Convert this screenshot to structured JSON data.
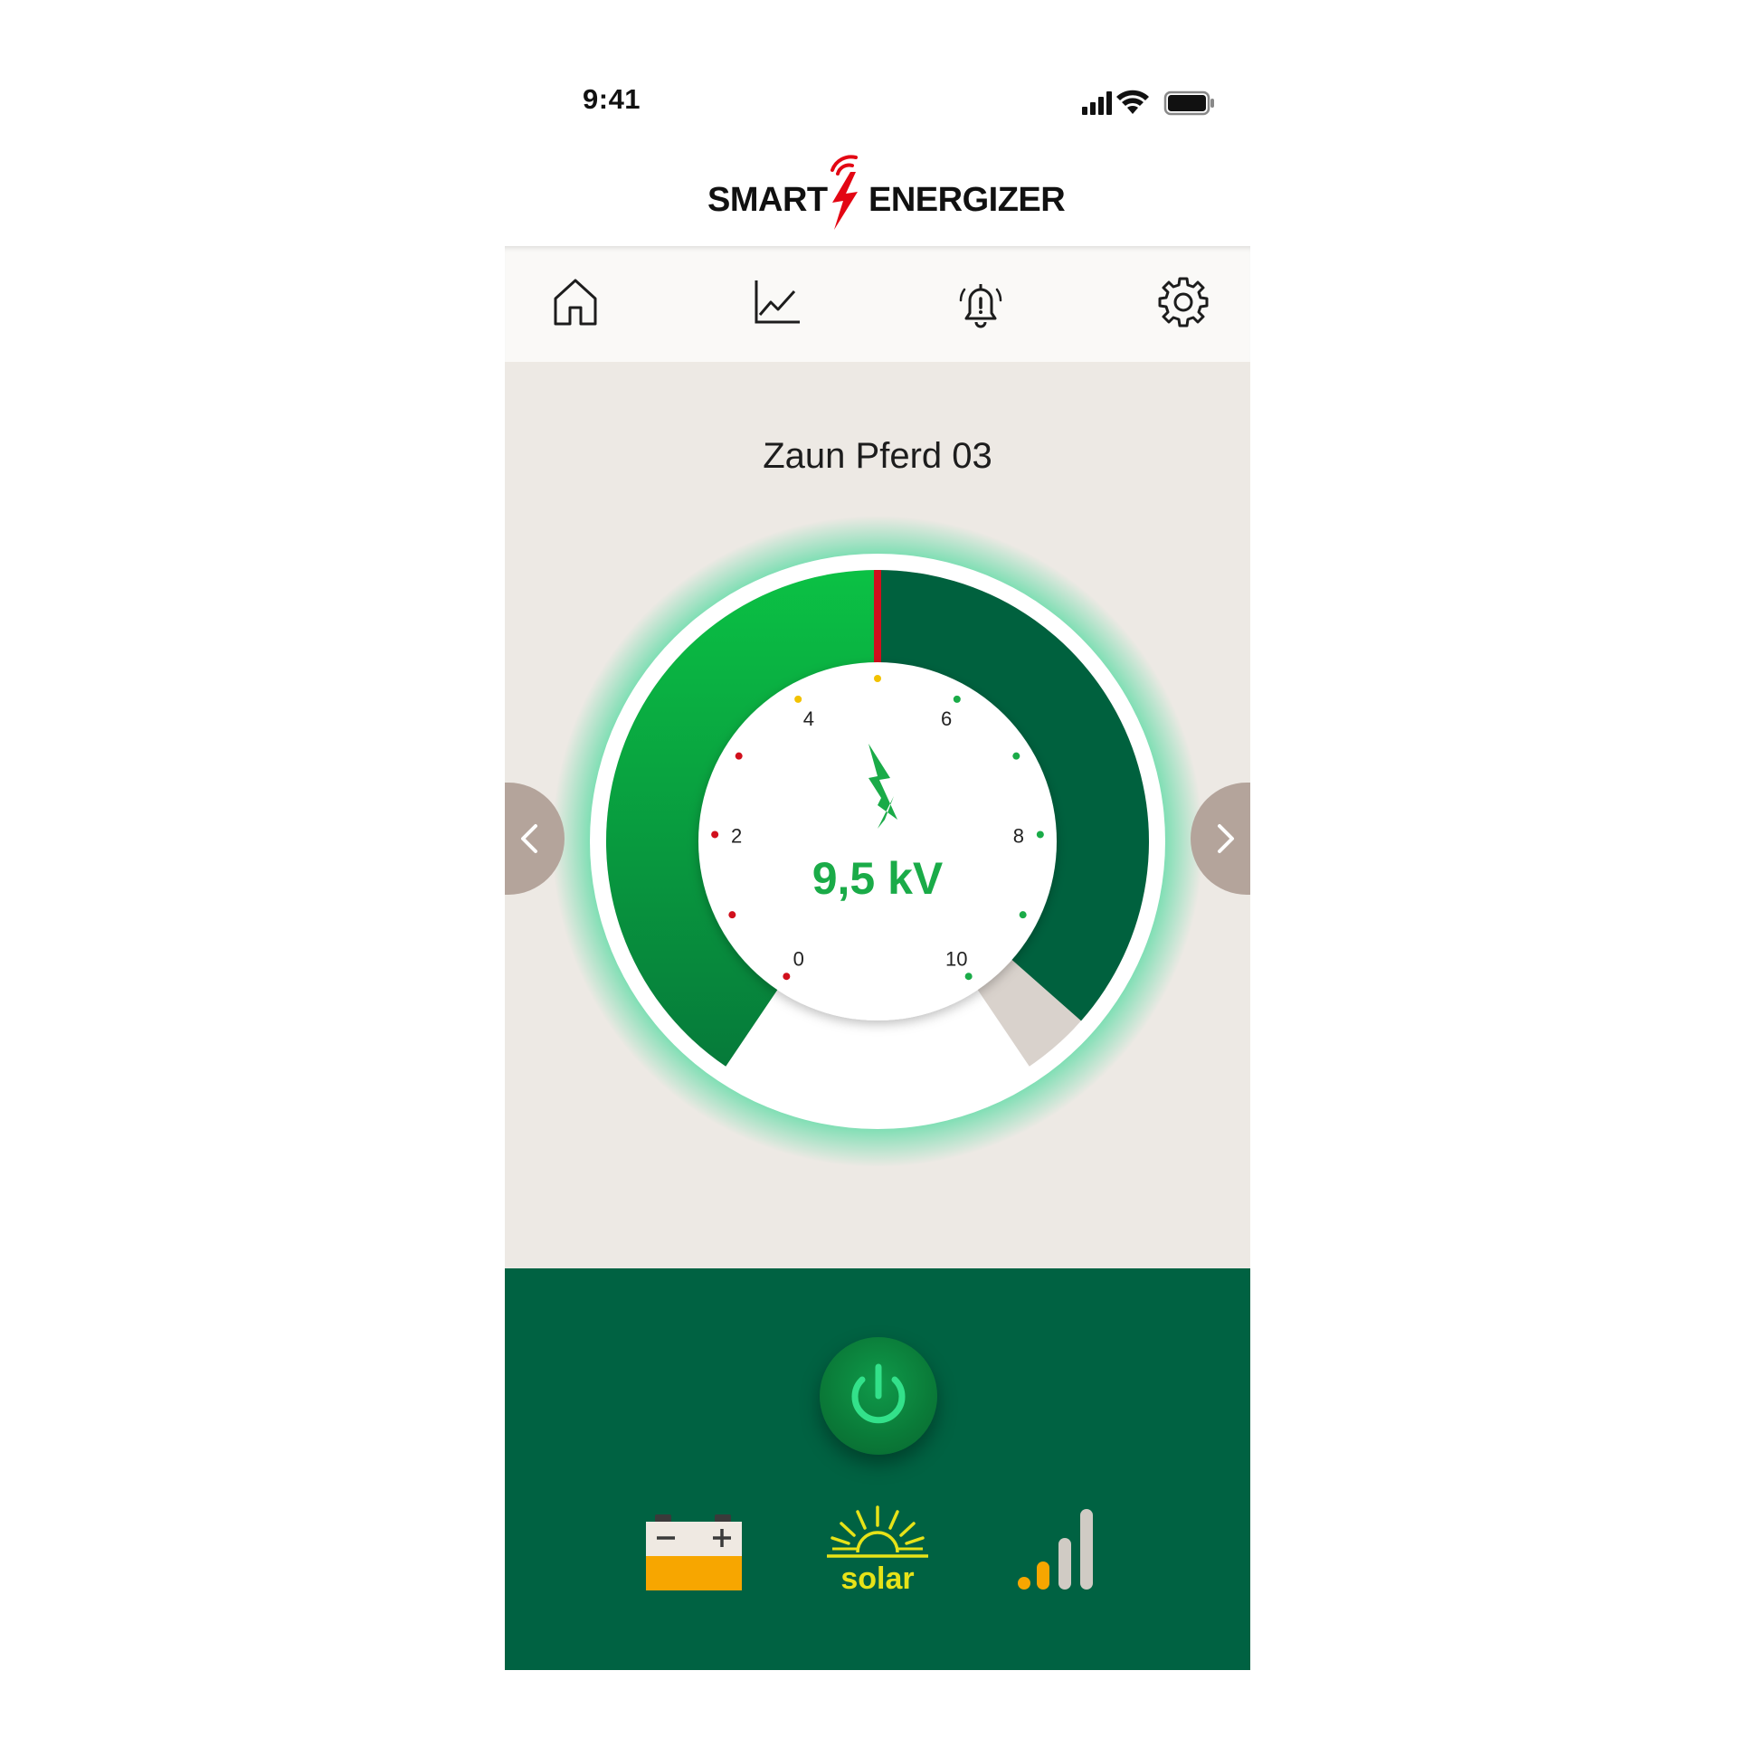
{
  "status_bar": {
    "time": "9:41",
    "icons": [
      "cellular-signal-icon",
      "wifi-icon",
      "battery-icon"
    ]
  },
  "header": {
    "logo_left": "SMART",
    "logo_right": "ENERGIZER",
    "logo_mark": "lightning-wireless-icon"
  },
  "nav": {
    "items": [
      {
        "icon": "home-icon"
      },
      {
        "icon": "chart-icon"
      },
      {
        "icon": "alarm-bell-icon"
      },
      {
        "icon": "gear-icon"
      }
    ]
  },
  "device": {
    "name": "Zaun Pferd 03"
  },
  "gauge": {
    "value_label": "9,5 kV",
    "value": 9.5,
    "unit": "kV",
    "threshold": 5,
    "min": 0,
    "max": 10,
    "ticks": [
      "0",
      "2",
      "4",
      "6",
      "8",
      "10"
    ],
    "colors": {
      "fill_light": "#0bc144",
      "fill_dark": "#00613e",
      "marker": "#d10f1c",
      "glow": "#1fd58a",
      "track": "#d9d2cc"
    }
  },
  "controls": {
    "prev": "chevron-left-icon",
    "next": "chevron-right-icon",
    "power": "power-icon"
  },
  "indicators": {
    "battery": {
      "icon": "car-battery-icon",
      "color": "#f7a600"
    },
    "solar": {
      "icon": "sun-icon",
      "label": "solar",
      "color": "#e7e318"
    },
    "signal": {
      "icon": "signal-bars-icon",
      "active_bars": 2,
      "total_bars": 4,
      "color": "#f7a600"
    }
  },
  "colors": {
    "brand_green": "#006242",
    "accent_red": "#e30613",
    "background": "#ede9e4"
  }
}
